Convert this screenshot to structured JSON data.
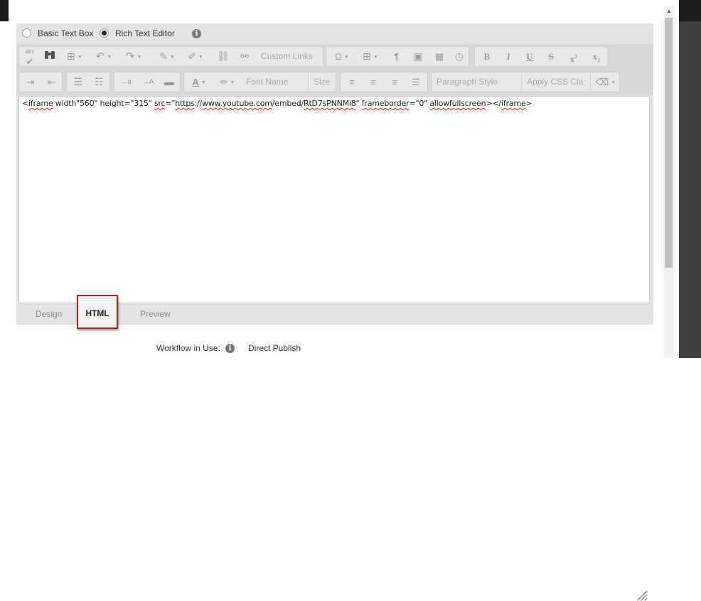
{
  "editor": {
    "modes": [
      {
        "label": "Basic Text Box",
        "selected": false
      },
      {
        "label": "Rich Text Editor",
        "selected": true
      }
    ],
    "toolbar": {
      "custom_links": "Custom Links",
      "font_name": "Font Name",
      "size": "Size",
      "paragraph_style": "Paragraph Style",
      "apply_css": "Apply CSS Cla",
      "bold": "B",
      "italic": "I",
      "underline": "U",
      "strike": "S",
      "superscript": "x",
      "subscript": "x",
      "superscript_mark": "2",
      "subscript_mark": "2",
      "omega": "Ω",
      "pilcrow": "¶",
      "insert_a": "→a",
      "insert_A": "→A",
      "font_color": "A",
      "spellcheck_label": "abc"
    },
    "content": {
      "t1": "<",
      "t2": "iframe",
      "t3": " width\"560\" height=\"315\" ",
      "t4": "src",
      "t5": "=\"",
      "t6": "https",
      "t7": "://",
      "t8": "www.youtube.com",
      "t9": "/embed/",
      "t10": "RtD7sPNNMi8",
      "t11": "\" ",
      "t12": "frameborder",
      "t13": "=\"0\" ",
      "t14": "allowfullscreen",
      "t15": "></",
      "t16": "iframe",
      "t17": ">"
    },
    "tabs": [
      {
        "label": "Design",
        "active": false
      },
      {
        "label": "HTML",
        "active": true
      },
      {
        "label": "Preview",
        "active": false
      }
    ]
  },
  "workflow": {
    "label": "Workflow in Use:",
    "value": "Direct Publish"
  },
  "icons": {
    "info": "i",
    "scroll_up": "▲"
  },
  "colors": {
    "highlight_border": "#b22222",
    "spellcheck_underline": "#dd2222"
  }
}
